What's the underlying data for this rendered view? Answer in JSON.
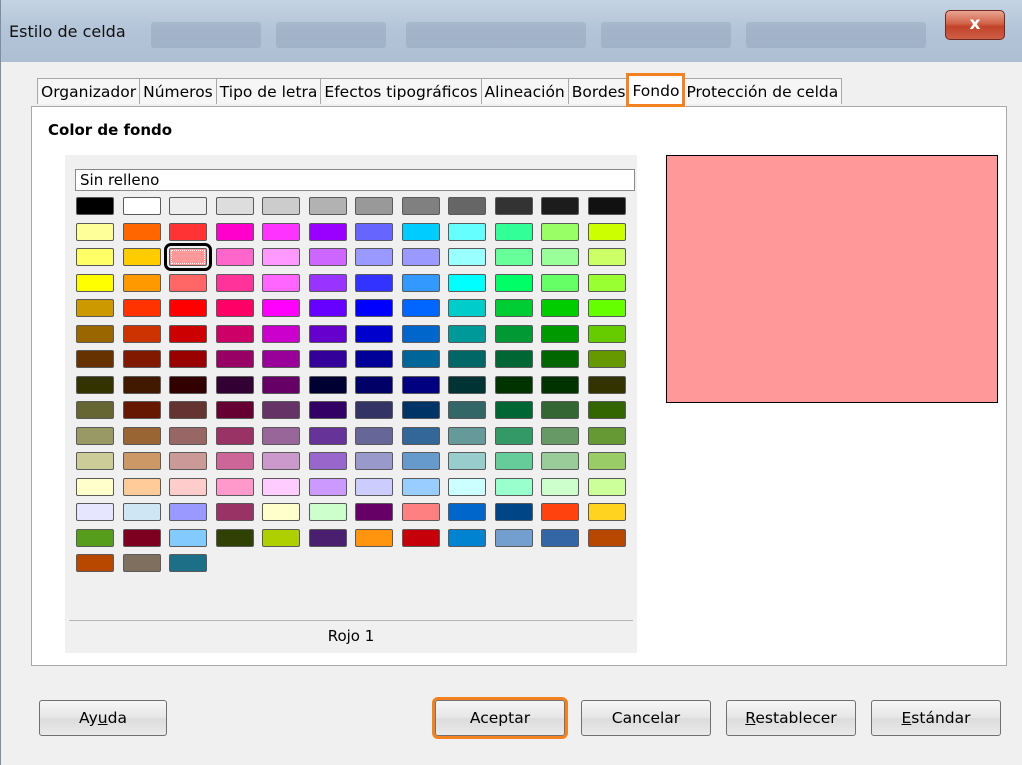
{
  "window": {
    "title": "Estilo de celda",
    "close_symbol": "x"
  },
  "tabs": [
    {
      "label": "Organizador",
      "active": false
    },
    {
      "label": "Números",
      "active": false
    },
    {
      "label": "Tipo de letra",
      "active": false
    },
    {
      "label": "Efectos tipográficos",
      "active": false
    },
    {
      "label": "Alineación",
      "active": false
    },
    {
      "label": "Bordes",
      "active": false
    },
    {
      "label": "Fondo",
      "active": true
    },
    {
      "label": "Protección de celda",
      "active": false
    }
  ],
  "background": {
    "section_title": "Color de fondo",
    "color_name_field": "Sin relleno",
    "selected_color_name": "Rojo 1",
    "preview_color": "#ff9999",
    "selected_index": 26,
    "palette_columns": 12,
    "palette": [
      "#000000",
      "#ffffff",
      "#eeeeee",
      "#dddddd",
      "#cccccc",
      "#b2b2b2",
      "#999999",
      "#808080",
      "#666666",
      "#333333",
      "#1c1c1c",
      "#111111",
      "#ffff99",
      "#ff6600",
      "#ff3333",
      "#ff00cc",
      "#ff33ff",
      "#9900ff",
      "#6666ff",
      "#00ccff",
      "#66ffff",
      "#33ff99",
      "#99ff66",
      "#ccff00",
      "#ffff66",
      "#ffcc00",
      "#ff9999",
      "#ff66cc",
      "#ff99ff",
      "#cc66ff",
      "#9999ff",
      "#9999ff",
      "#99ffff",
      "#66ff99",
      "#99ff99",
      "#ccff66",
      "#ffff00",
      "#ff9900",
      "#ff6666",
      "#ff3399",
      "#ff66ff",
      "#9933ff",
      "#3333ff",
      "#3399ff",
      "#00ffff",
      "#00ff66",
      "#66ff66",
      "#99ff33",
      "#cc9900",
      "#ff3300",
      "#ff0000",
      "#ff0066",
      "#ff00ff",
      "#6600ff",
      "#0000ff",
      "#0066ff",
      "#00cccc",
      "#00cc33",
      "#00cc00",
      "#66ff00",
      "#996600",
      "#cc3300",
      "#cc0000",
      "#cc0066",
      "#cc00cc",
      "#6600cc",
      "#0000cc",
      "#0066cc",
      "#009999",
      "#009933",
      "#009900",
      "#66cc00",
      "#663300",
      "#801900",
      "#990000",
      "#990066",
      "#990099",
      "#330099",
      "#000099",
      "#006699",
      "#006666",
      "#006633",
      "#006600",
      "#669900",
      "#333300",
      "#401900",
      "#330000",
      "#330033",
      "#660066",
      "#000033",
      "#000066",
      "#000080",
      "#003333",
      "#003300",
      "#003300",
      "#333300",
      "#666633",
      "#661900",
      "#663333",
      "#660033",
      "#663366",
      "#330066",
      "#333366",
      "#003366",
      "#336666",
      "#006633",
      "#336633",
      "#336600",
      "#999966",
      "#996633",
      "#996666",
      "#993366",
      "#996699",
      "#663399",
      "#666699",
      "#336699",
      "#669999",
      "#339966",
      "#669966",
      "#669933",
      "#cccc99",
      "#cc9966",
      "#cc9999",
      "#cc6699",
      "#cc99cc",
      "#9966cc",
      "#9999cc",
      "#6699cc",
      "#99cccc",
      "#66cc99",
      "#99cc99",
      "#99cc66",
      "#ffffcc",
      "#ffcc99",
      "#ffcccc",
      "#ff99cc",
      "#ffccff",
      "#cc99ff",
      "#ccccff",
      "#99ccff",
      "#ccffff",
      "#99ffcc",
      "#ccffcc",
      "#ccff99",
      "#e6e6ff",
      "#cfe7f5",
      "#9999ff",
      "#993366",
      "#ffffcc",
      "#ccffcc",
      "#660066",
      "#ff8080",
      "#0066cc",
      "#004586",
      "#ff420e",
      "#ffd320",
      "#579d1c",
      "#7e0021",
      "#83caff",
      "#314004",
      "#aecf00",
      "#4b1f6f",
      "#ff950e",
      "#c5000b",
      "#0084d1",
      "#729fcf",
      "#3465a4",
      "#b84700",
      "#b84700",
      "#7f6f5f",
      "#1c6f86"
    ]
  },
  "buttons": {
    "help": {
      "pre": "Ay",
      "ul": "u",
      "post": "da"
    },
    "ok": "Aceptar",
    "cancel": "Cancelar",
    "reset": {
      "pre": "",
      "ul": "R",
      "post": "establecer"
    },
    "standard": {
      "pre": "",
      "ul": "E",
      "post": "stándar"
    }
  }
}
